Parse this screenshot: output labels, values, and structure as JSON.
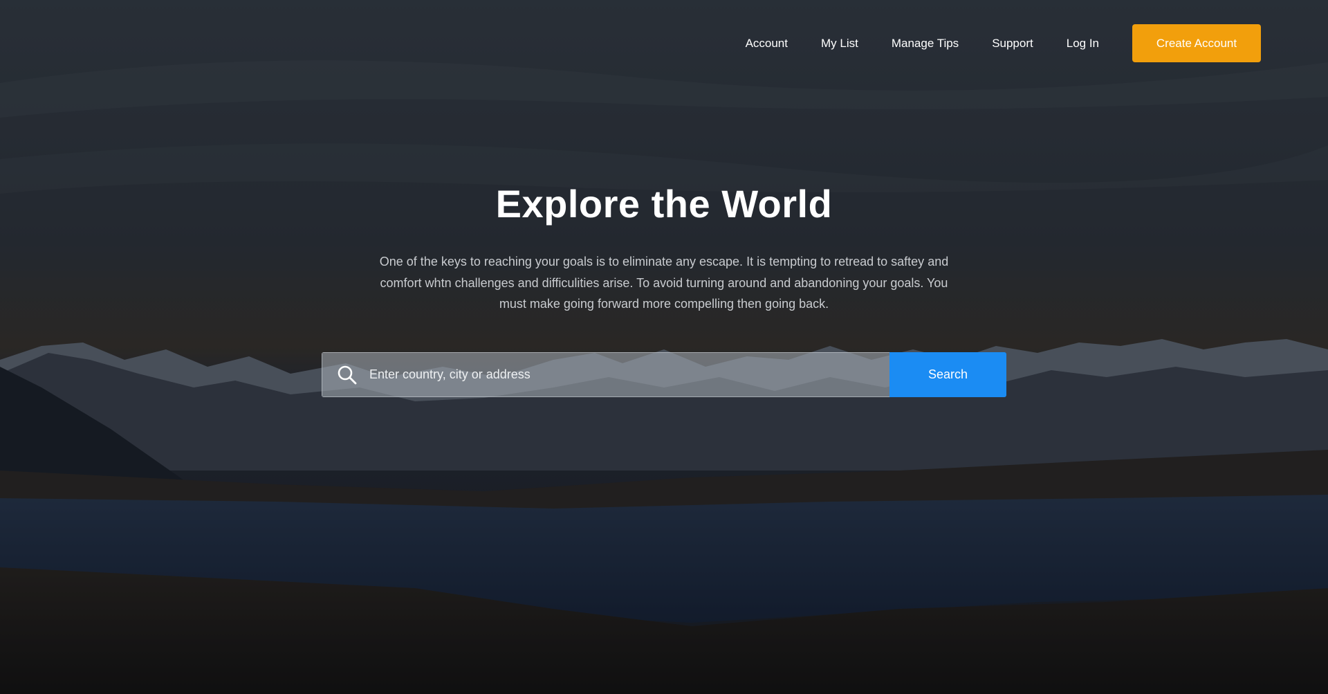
{
  "nav": {
    "links": [
      {
        "label": "Account"
      },
      {
        "label": "My List"
      },
      {
        "label": "Manage Tips"
      },
      {
        "label": "Support"
      },
      {
        "label": "Log In"
      }
    ],
    "cta_label": "Create Account"
  },
  "hero": {
    "title": "Explore the World",
    "description": "One of the keys to reaching your goals is to eliminate any escape. It is tempting to retread to saftey and comfort whtn challenges and difficulities arise. To avoid turning around and abandoning your goals. You must make going forward more compelling then going back."
  },
  "search": {
    "placeholder": "Enter country, city or address",
    "button_label": "Search",
    "icon": "search-icon"
  },
  "colors": {
    "cta": "#f29f0c",
    "search_button": "#1b8cf3",
    "text": "#ffffff"
  }
}
